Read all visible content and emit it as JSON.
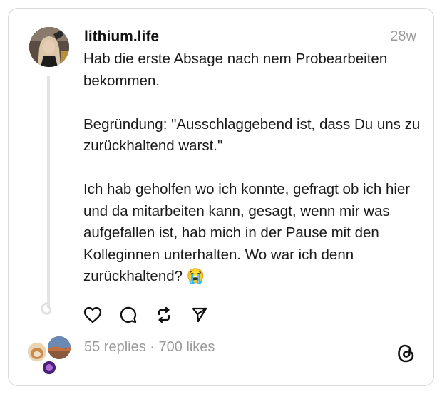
{
  "post": {
    "username": "lithium.life",
    "timestamp": "28w",
    "paragraphs": [
      "Hab die erste Absage nach nem Probearbeiten bekommen.",
      "Begründung: \"Ausschlaggebend ist, dass Du uns zu zurückhaltend warst.\"",
      "Ich hab geholfen wo ich konnte, gefragt ob ich hier und da mitarbeiten kann, gesagt, wenn mir was aufgefallen ist, hab mich in der Pause mit den Kolleginnen unterhalten. Wo war ich denn zurückhaltend? 😭"
    ]
  },
  "actions": {
    "like_icon": "heart-icon",
    "reply_icon": "comment-icon",
    "repost_icon": "repost-icon",
    "share_icon": "send-icon"
  },
  "footer": {
    "stats": "55 replies · 700 likes",
    "logo_icon": "threads-logo-icon"
  }
}
